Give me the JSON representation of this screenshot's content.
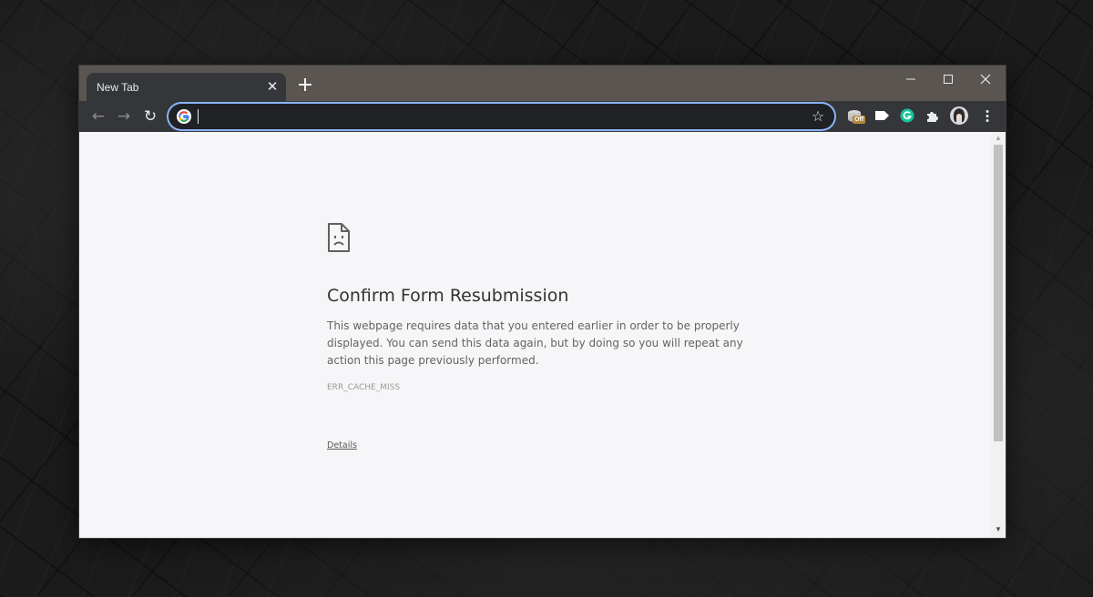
{
  "browser": {
    "tab": {
      "title": "New Tab",
      "close_icon": "close-icon"
    },
    "new_tab_icon": "plus-icon",
    "window_controls": [
      "minimize-icon",
      "maximize-icon",
      "close-icon"
    ],
    "toolbar": {
      "back_icon": "arrow-left-icon",
      "forward_icon": "arrow-right-icon",
      "reload_icon": "reload-icon",
      "omnibox": {
        "value": "",
        "placeholder": ""
      },
      "bookmark_icon": "star-icon",
      "extensions": [
        {
          "name": "cookie-extension-icon",
          "badge": "Off"
        },
        {
          "name": "label-extension-icon"
        },
        {
          "name": "grammarly-icon"
        },
        {
          "name": "puzzle-extensions-icon"
        },
        {
          "name": "profile-avatar"
        },
        {
          "name": "kebab-menu-icon"
        }
      ]
    },
    "colors": {
      "titlebar": "#5a5550",
      "toolbar": "#35363a",
      "focus_ring": "#8ab4f8",
      "page_background": "#f6f5f7"
    }
  },
  "error_page": {
    "icon": "sad-document-icon",
    "title": "Confirm Form Resubmission",
    "message": "This webpage requires data that you entered earlier in order to be properly displayed. You can send this data again, but by doing so you will repeat any action this page previously performed.",
    "error_code": "ERR_CACHE_MISS",
    "details_link": "Details"
  }
}
